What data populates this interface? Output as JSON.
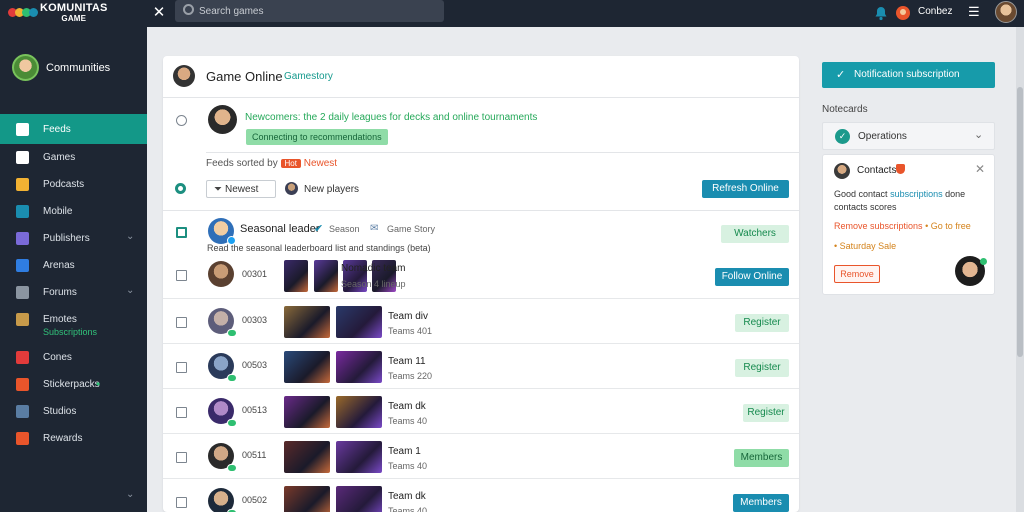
{
  "app": {
    "logo_title": "KOMUNITAS",
    "logo_sub": "GAME",
    "logo_colors": [
      "#e23b3b",
      "#f2b233",
      "#2fbf71",
      "#1a8db0"
    ]
  },
  "topbar": {
    "search_placeholder": "Search games",
    "user_name": "Conbez",
    "icons": [
      "close-icon",
      "search-icon",
      "notification-icon",
      "avatar-icon",
      "menu-icon"
    ]
  },
  "sidebar": {
    "profile_name": "Communities",
    "items": [
      {
        "label": "Feeds",
        "icon": "home-icon",
        "color": "#ffffff",
        "active": true
      },
      {
        "label": "Games",
        "icon": "gamepad-icon",
        "color": "#ffffff"
      },
      {
        "label": "Podcasts",
        "icon": "podcast-icon",
        "color": "#f2b233"
      },
      {
        "label": "Mobile",
        "icon": "mobile-icon",
        "color": "#1a8db0"
      },
      {
        "label": "Publishers",
        "icon": "publisher-icon",
        "color": "#7a6ad8",
        "chevron": true
      },
      {
        "label": "Arenas",
        "icon": "arena-icon",
        "color": "#2f7de1"
      },
      {
        "label": "Forums",
        "icon": "forum-icon",
        "color": "#8b95a1",
        "chevron": true
      },
      {
        "label": "Emotes",
        "sub": "Subscriptions",
        "icon": "emote-icon",
        "color": "#c79a4a"
      },
      {
        "label": "Cones",
        "icon": "cone-icon",
        "color": "#e23b3b"
      },
      {
        "label": "Stickerpacks",
        "icon": "sticker-icon",
        "color": "#e9552b",
        "badge": "•"
      },
      {
        "label": "Studios",
        "icon": "studio-icon",
        "color": "#5a7da3"
      },
      {
        "label": "Rewards",
        "icon": "reward-icon",
        "color": "#e9552b"
      }
    ]
  },
  "feed": {
    "header_title": "Game Online",
    "header_subtitle": "Gamestory",
    "post": {
      "title": "Newcomers: the 2 daily leagues for decks and online tournaments",
      "tag": "Connecting to recommendations",
      "meta_prefix": "Feeds sorted by",
      "meta_badge": "Hot",
      "meta_link": "Newest",
      "filter_label": "Newest",
      "mini_label": "New players",
      "action_label": "Refresh Online"
    },
    "thread": {
      "name": "Seasonal leader",
      "sub1": "Season",
      "sub2": "Game Story",
      "description": "Read the seasonal leaderboard list and standings (beta)",
      "button": "Watchers"
    },
    "rows": [
      {
        "num": "00301",
        "t1": "Nomadic team",
        "t2": "Season 4 lineup",
        "button": "Follow Online",
        "button_style": "teal",
        "thumbs": [
          "#3b2a6a",
          "#5a3a9a"
        ],
        "avatar": [
          "#c89c76",
          "#5a4030"
        ]
      },
      {
        "num": "00303",
        "t1": "Team div",
        "t2": "Teams 401",
        "button": "Register",
        "button_style": "soft",
        "thumbs": [
          "#8a6a3a",
          "#2a3a6a"
        ],
        "avatar": [
          "#c4b0a8",
          "#5d5d7a"
        ]
      },
      {
        "num": "00503",
        "t1": "Team 11",
        "t2": "Teams 220",
        "button": "Register",
        "button_style": "soft",
        "thumbs": [
          "#2a4a7a",
          "#7a2aa0"
        ],
        "avatar": [
          "#8aa4c8",
          "#2a3a5a"
        ]
      },
      {
        "num": "00513",
        "t1": "Team dk",
        "t2": "Teams 40",
        "button": "Register",
        "button_style": "soft",
        "thumbs": [
          "#6a2a8a",
          "#9a6a2a"
        ],
        "avatar": [
          "#b08ac8",
          "#3a2a6a"
        ]
      },
      {
        "num": "00511",
        "t1": "Team 1",
        "t2": "Teams 40",
        "button": "Members",
        "button_style": "mid",
        "thumbs": [
          "#5a2a2a",
          "#6a3aa0"
        ],
        "avatar": [
          "#d0a886",
          "#2a2a2a"
        ]
      },
      {
        "num": "00502",
        "t1": "Team dk",
        "t2": "Teams 40",
        "button": "Members",
        "button_style": "teal",
        "thumbs": [
          "#7a3a2a",
          "#5a2a7a"
        ],
        "avatar": [
          "#d6b08c",
          "#1d2a3a"
        ]
      }
    ]
  },
  "right_panel": {
    "primary_button": "Notification subscription",
    "section_label": "Notecards",
    "select_value": "Operations",
    "card": {
      "name": "Contacts",
      "line1_a": "Good contact",
      "line1_b": "subscriptions",
      "line1_c": "done",
      "line2": "contacts scores",
      "line3": "Remove subscriptions",
      "line3_tail": "• Go to free",
      "line4": "• Saturday Sale",
      "button": "Remove"
    }
  }
}
